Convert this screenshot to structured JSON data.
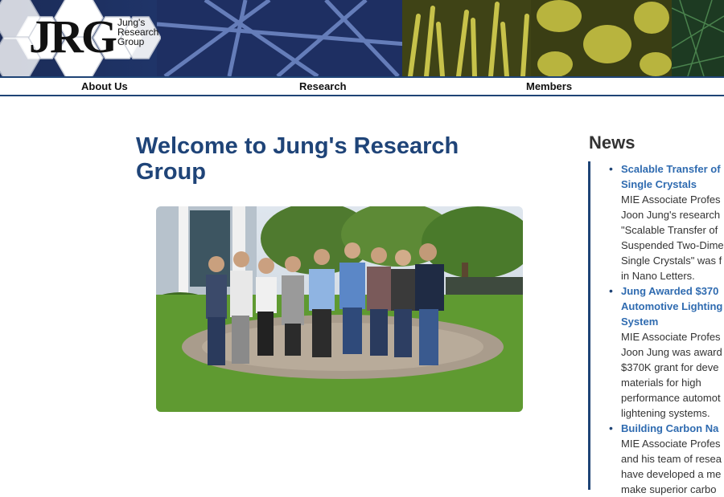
{
  "brand": {
    "logo_letters": "JRG",
    "logo_sub_lines": [
      "Jung's",
      "Research",
      "Group"
    ]
  },
  "nav": {
    "items": [
      {
        "label": "About Us"
      },
      {
        "label": "Research"
      },
      {
        "label": "Members"
      }
    ]
  },
  "main": {
    "title": "Welcome to Jung's Research Group"
  },
  "news": {
    "heading": "News",
    "items": [
      {
        "title_lines": [
          "Scalable Transfer of",
          "Single Crystals"
        ],
        "text_lines": [
          "MIE Associate Profes",
          "Joon Jung's research",
          "\"Scalable Transfer of",
          "Suspended Two-Dime",
          "Single Crystals\" was f",
          "in Nano Letters."
        ]
      },
      {
        "title_lines": [
          "Jung Awarded $370",
          "Automotive Lighting",
          "System"
        ],
        "text_lines": [
          "MIE Associate Profes",
          "Joon Jung was award",
          "$370K grant for deve",
          "materials for high",
          "performance automot",
          "lightening systems."
        ]
      },
      {
        "title_lines": [
          "Building Carbon Na"
        ],
        "text_lines": [
          "MIE Associate Profes",
          "and his team of resea",
          "have developed a me",
          "make superior carbo"
        ]
      }
    ]
  },
  "colors": {
    "title": "#1f4478",
    "nav_border": "#1f4476",
    "news_link": "#2f6bb0"
  }
}
